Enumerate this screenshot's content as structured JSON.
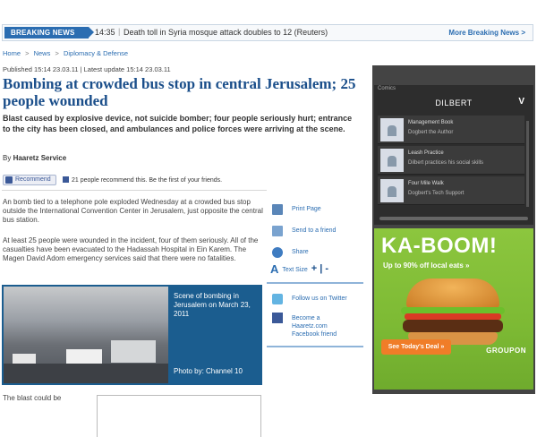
{
  "breaking": {
    "label": "BREAKING NEWS",
    "time": "14:35",
    "separator": "|",
    "headline": "Death toll in Syria mosque attack doubles to 12 (Reuters)",
    "more": "More Breaking News >"
  },
  "breadcrumb": {
    "items": [
      "Home",
      "News",
      "Diplomacy & Defense"
    ],
    "separator": ">"
  },
  "article": {
    "published": "Published 15:14 23.03.11  |  Latest update 15:14 23.03.11",
    "title": "Bombing at crowded bus stop in central Jerusalem; 25 people wounded",
    "subhead": "Blast caused by explosive device, not suicide bomber; four people seriously hurt; entrance to the city has been closed, and ambulances and police forces were arriving at the scene.",
    "byline_prefix": "By ",
    "byline_author": "Haaretz Service",
    "recommend_label": "Recommend",
    "recommend_text": "21 people recommend this. Be the first of your friends.",
    "para1": "An bomb tied to a telephone pole exploded Wednesday at a crowded bus stop outside the International Convention Center in Jerusalem, just opposite the central bus station.",
    "para2": "At least 25 people were wounded in the incident, four of them seriously. All of the casualties have been evacuated to the Hadassah Hospital in Ein Karem. The Magen David Adom emergency services said that there were no fatalities.",
    "photo_caption": "Scene of bombing in Jerusalem on March 23, 2011",
    "photo_credit": "Photo by:  Channel 10",
    "continued": "The blast could be"
  },
  "tools": {
    "print": "Print Page",
    "send": "Send to a friend",
    "share": "Share",
    "text_size": "Text Size",
    "text_size_controls": "+ | -",
    "twitter": "Follow us on Twitter",
    "facebook": "Become a Haaretz.com Facebook friend"
  },
  "widget": {
    "tab": "Comics",
    "title": "DILBERT",
    "close": "V",
    "items": [
      {
        "title": "Management Book",
        "desc": "Dogbert the Author"
      },
      {
        "title": "Leash Practice",
        "desc": "Dilbert practices his social skills"
      },
      {
        "title": "Four Mile Walk",
        "desc": "Dogbert's Tech Support"
      }
    ]
  },
  "ad": {
    "headline": "KA-BOOM!",
    "offer": "Up to 90% off local eats »",
    "cta": "See Today's Deal »",
    "brand": "GROUPON"
  }
}
